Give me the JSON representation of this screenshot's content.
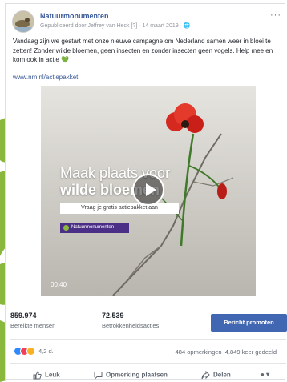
{
  "post": {
    "page_name": "Natuurmonumenten",
    "meta": "Gepubliceerd door Jeffrey van Heck [?] · 14 maart 2019 · ",
    "more": "···",
    "text": "Vandaag zijn we gestart met onze nieuwe campagne om Nederland samen weer in bloei te zetten! Zonder wilde bloemen, geen insecten en zonder insecten geen vogels. Help mee en kom ook in actie 💚",
    "link": "www.nm.nl/actiepakket"
  },
  "video": {
    "headline_line1": "Maak plaats voor",
    "headline_line2": "wilde bloemen",
    "cta": "Vraag je gratis actiepakket aan",
    "brand": "Natuurmonumenten",
    "duration": "00:40"
  },
  "stats": {
    "reach_value": "859.974",
    "reach_label": "Bereikte mensen",
    "engagement_value": "72.539",
    "engagement_label": "Betrokkenheidsacties",
    "promote_label": "Bericht promoten"
  },
  "reactions": {
    "count": "4,2 d.",
    "comments": "484 opmerkingen",
    "shares": "4.849 keer gedeeld"
  },
  "actions": {
    "like": "Leuk",
    "comment": "Opmerking plaatsen",
    "share": "Delen"
  },
  "colors": {
    "link": "#385898",
    "promote": "#4267b2",
    "brand_purple": "#4b2f87",
    "leaf_green": "#8ab83c"
  }
}
